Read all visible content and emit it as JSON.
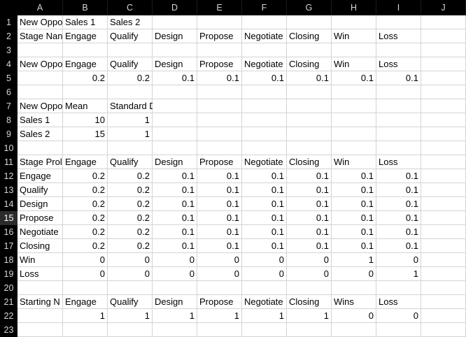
{
  "columns": [
    "A",
    "B",
    "C",
    "D",
    "E",
    "F",
    "G",
    "H",
    "I",
    "J"
  ],
  "rows": [
    "1",
    "2",
    "3",
    "4",
    "5",
    "6",
    "7",
    "8",
    "9",
    "10",
    "11",
    "12",
    "13",
    "14",
    "15",
    "16",
    "17",
    "18",
    "19",
    "20",
    "21",
    "22",
    "23"
  ],
  "selected_row": "15",
  "cells": [
    [
      "New Oppo",
      "Sales 1",
      "Sales 2",
      "",
      "",
      "",
      "",
      "",
      "",
      ""
    ],
    [
      "Stage Nan",
      "Engage",
      "Qualify",
      "Design",
      "Propose",
      "Negotiate",
      "Closing",
      "Win",
      "Loss",
      ""
    ],
    [
      "",
      "",
      "",
      "",
      "",
      "",
      "",
      "",
      "",
      ""
    ],
    [
      "New Oppo",
      "Engage",
      "Qualify",
      "Design",
      "Propose",
      "Negotiate",
      "Closing",
      "Win",
      "Loss",
      ""
    ],
    [
      "",
      "0.2",
      "0.2",
      "0.1",
      "0.1",
      "0.1",
      "0.1",
      "0.1",
      "0.1",
      ""
    ],
    [
      "",
      "",
      "",
      "",
      "",
      "",
      "",
      "",
      "",
      ""
    ],
    [
      "New Oppo",
      "Mean",
      "Standard Deviation",
      "",
      "",
      "",
      "",
      "",
      "",
      ""
    ],
    [
      "Sales 1",
      "10",
      "1",
      "",
      "",
      "",
      "",
      "",
      "",
      ""
    ],
    [
      "Sales 2",
      "15",
      "1",
      "",
      "",
      "",
      "",
      "",
      "",
      ""
    ],
    [
      "",
      "",
      "",
      "",
      "",
      "",
      "",
      "",
      "",
      ""
    ],
    [
      "Stage Prol",
      "Engage",
      "Qualify",
      "Design",
      "Propose",
      "Negotiate",
      "Closing",
      "Win",
      "Loss",
      ""
    ],
    [
      "Engage",
      "0.2",
      "0.2",
      "0.1",
      "0.1",
      "0.1",
      "0.1",
      "0.1",
      "0.1",
      ""
    ],
    [
      "Qualify",
      "0.2",
      "0.2",
      "0.1",
      "0.1",
      "0.1",
      "0.1",
      "0.1",
      "0.1",
      ""
    ],
    [
      "Design",
      "0.2",
      "0.2",
      "0.1",
      "0.1",
      "0.1",
      "0.1",
      "0.1",
      "0.1",
      ""
    ],
    [
      "Propose",
      "0.2",
      "0.2",
      "0.1",
      "0.1",
      "0.1",
      "0.1",
      "0.1",
      "0.1",
      ""
    ],
    [
      "Negotiate",
      "0.2",
      "0.2",
      "0.1",
      "0.1",
      "0.1",
      "0.1",
      "0.1",
      "0.1",
      ""
    ],
    [
      "Closing",
      "0.2",
      "0.2",
      "0.1",
      "0.1",
      "0.1",
      "0.1",
      "0.1",
      "0.1",
      ""
    ],
    [
      "Win",
      "0",
      "0",
      "0",
      "0",
      "0",
      "0",
      "1",
      "0",
      ""
    ],
    [
      "Loss",
      "0",
      "0",
      "0",
      "0",
      "0",
      "0",
      "0",
      "1",
      ""
    ],
    [
      "",
      "",
      "",
      "",
      "",
      "",
      "",
      "",
      "",
      ""
    ],
    [
      "Starting N",
      "Engage",
      "Qualify",
      "Design",
      "Propose",
      "Negotiate",
      "Closing",
      "Wins",
      "Loss",
      ""
    ],
    [
      "",
      "1",
      "1",
      "1",
      "1",
      "1",
      "1",
      "0",
      "0",
      ""
    ],
    [
      "",
      "",
      "",
      "",
      "",
      "",
      "",
      "",
      "",
      ""
    ]
  ]
}
